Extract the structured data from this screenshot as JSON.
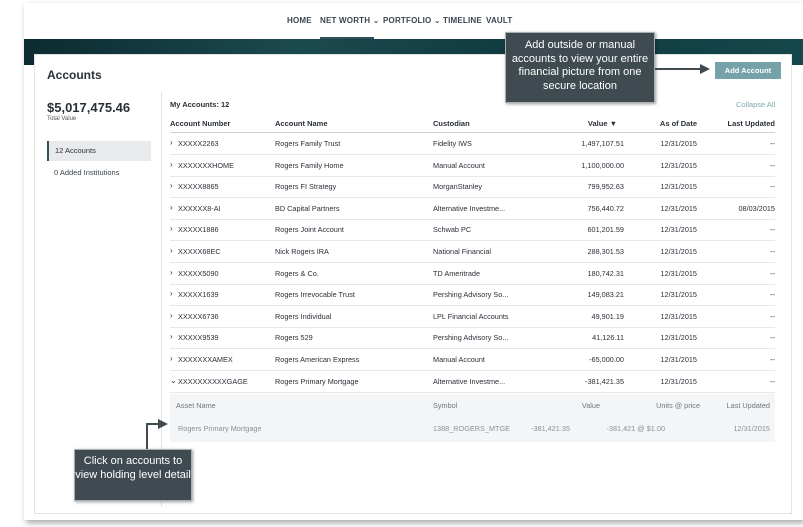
{
  "nav": [
    {
      "label": "HOME",
      "dropdown": false
    },
    {
      "label": "NET WORTH",
      "dropdown": true
    },
    {
      "label": "PORTFOLIO",
      "dropdown": true
    },
    {
      "label": "TIMELINE",
      "dropdown": false
    },
    {
      "label": "VAULT",
      "dropdown": false
    }
  ],
  "page": {
    "title": "Accounts",
    "add_button": "Add Account",
    "total_value": "$5,017,475.46",
    "total_label": "Total Value"
  },
  "sidebar": {
    "accounts": "12 Accounts",
    "institutions": "0 Added Institutions"
  },
  "table": {
    "my_accounts": "My Accounts: 12",
    "collapse_all": "Collapse All",
    "headers": {
      "number": "Account Number",
      "name": "Account Name",
      "custodian": "Custodian",
      "value": "Value",
      "as_of": "As of Date",
      "updated": "Last Updated"
    },
    "rows": [
      {
        "number": "XXXXX2263",
        "name": "Rogers Family Trust",
        "custodian": "Fidelity IWS",
        "value": "1,497,107.51",
        "as_of": "12/31/2015",
        "updated": "--"
      },
      {
        "number": "XXXXXXXHOME",
        "name": "Rogers Family Home",
        "custodian": "Manual Account",
        "value": "1,100,000.00",
        "as_of": "12/31/2015",
        "updated": "--"
      },
      {
        "number": "XXXXX8865",
        "name": "Rogers FI Strategy",
        "custodian": "MorganStanley",
        "value": "799,952.63",
        "as_of": "12/31/2015",
        "updated": "--"
      },
      {
        "number": "XXXXXX8-AI",
        "name": "BD Capital Partners",
        "custodian": "Alternative Investme...",
        "value": "756,440.72",
        "as_of": "12/31/2015",
        "updated": "08/03/2015"
      },
      {
        "number": "XXXXX1886",
        "name": "Rogers Joint Account",
        "custodian": "Schwab PC",
        "value": "601,201.59",
        "as_of": "12/31/2015",
        "updated": "--"
      },
      {
        "number": "XXXXX68EC",
        "name": "Nick Rogers IRA",
        "custodian": "National Financial",
        "value": "288,301.53",
        "as_of": "12/31/2015",
        "updated": "--"
      },
      {
        "number": "XXXXX5090",
        "name": "Rogers & Co.",
        "custodian": "TD Ameritrade",
        "value": "180,742.31",
        "as_of": "12/31/2015",
        "updated": "--"
      },
      {
        "number": "XXXXX1639",
        "name": "Rogers Irrevocable Trust",
        "custodian": "Pershing Advisory So...",
        "value": "149,083.21",
        "as_of": "12/31/2015",
        "updated": "--"
      },
      {
        "number": "XXXXX6736",
        "name": "Rogers Individual",
        "custodian": "LPL Financial Accounts",
        "value": "49,901.19",
        "as_of": "12/31/2015",
        "updated": "--"
      },
      {
        "number": "XXXXX9539",
        "name": "Rogers 529",
        "custodian": "Pershing Advisory So...",
        "value": "41,126.11",
        "as_of": "12/31/2015",
        "updated": "--"
      },
      {
        "number": "XXXXXXXAMEX",
        "name": "Rogers American Express",
        "custodian": "Manual Account",
        "value": "-65,000.00",
        "as_of": "12/31/2015",
        "updated": "--"
      },
      {
        "number": "XXXXXXXXXXGAGE",
        "name": "Rogers Primary Mortgage",
        "custodian": "Alternative Investme...",
        "value": "-381,421.35",
        "as_of": "12/31/2015",
        "updated": "--",
        "expanded": true
      }
    ],
    "holding": {
      "headers": {
        "asset": "Asset Name",
        "symbol": "Symbol",
        "value": "Value",
        "units": "Units @ price",
        "updated": "Last Updated"
      },
      "row": {
        "asset": "Rogers Primary Mortgage",
        "symbol": "1388_ROGERS_MTGE",
        "value": "-381,421.35",
        "units": "-381,421 @ $1.00",
        "updated": "12/31/2015"
      }
    }
  },
  "callouts": {
    "top": "Add outside or manual accounts to view your entire financial picture from one secure location",
    "bottom": "Click on accounts to view holding level detail"
  }
}
